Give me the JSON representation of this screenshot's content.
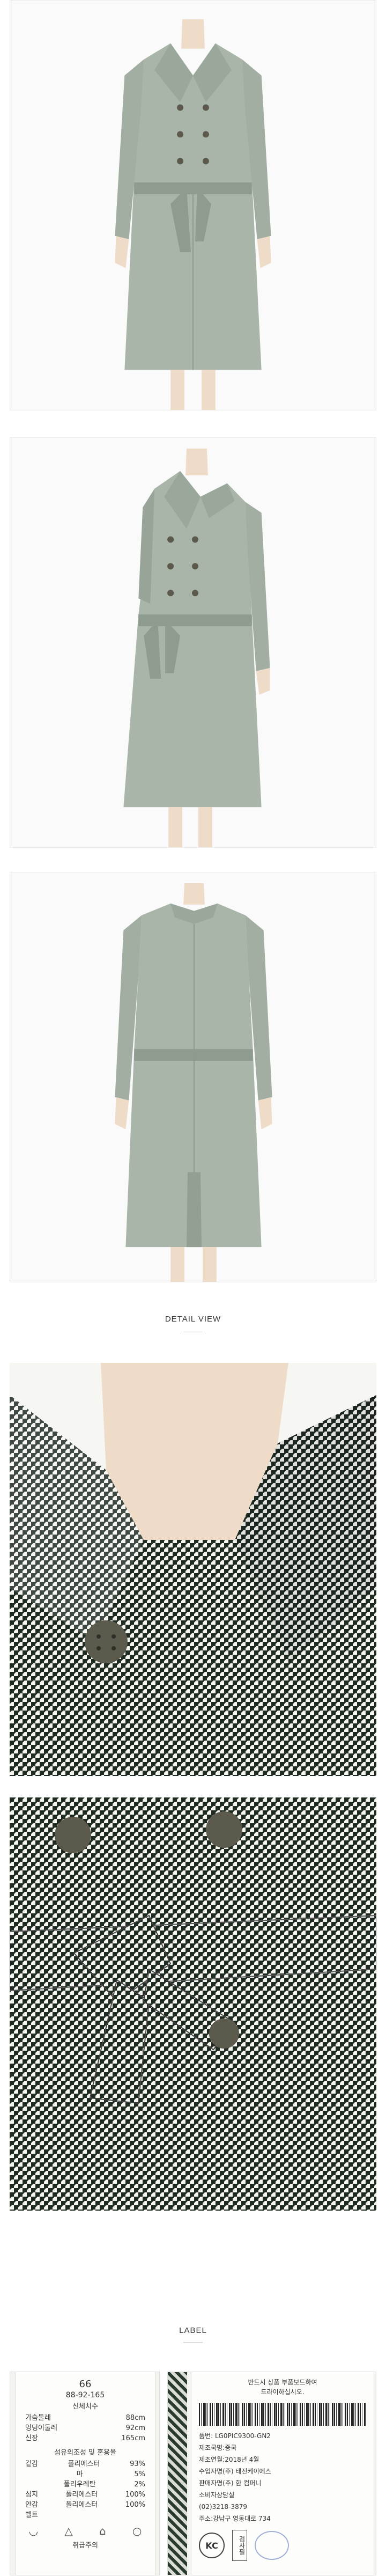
{
  "labels": {
    "detail_view": "DETAIL VIEW",
    "label": "LABEL"
  },
  "colors": {
    "coat_main": "#a9b5a9",
    "coat_shadow": "#8e9b8f",
    "button": "#5b5a4c",
    "skin": "#efdcc8",
    "houndstooth_dark": "#1f2a22",
    "houndstooth_light": "#f5f5f0"
  },
  "size_tag": {
    "size_code": "66",
    "size_numbers": "88-92-165",
    "body_size_title": "신체치수",
    "measurements": [
      {
        "name": "가슴둘레",
        "value": "88cm"
      },
      {
        "name": "엉덩이둘레",
        "value": "92cm"
      },
      {
        "name": "신장",
        "value": "165cm"
      }
    ],
    "fiber_title": "섬유의조성 및 혼용율",
    "fibers": [
      {
        "part": "겉감",
        "material": "폴리에스터",
        "pct": "93%"
      },
      {
        "part": "",
        "material": "마",
        "pct": "5%"
      },
      {
        "part": "",
        "material": "폴리우레탄",
        "pct": "2%"
      },
      {
        "part": "심지",
        "material": "폴리에스터",
        "pct": "100%"
      },
      {
        "part": "안감",
        "material": "폴리에스터",
        "pct": "100%"
      },
      {
        "part": "벨트",
        "material": "",
        "pct": ""
      }
    ],
    "care_title": "취급주의"
  },
  "info_tag": {
    "notice_line1": "반드시 상품 부품보드하여",
    "notice_line2": "드라이하십시오.",
    "lines": [
      "품번: LG0PIC9300-GN2",
      "제조국명:중국",
      "제조연월:2018년 4월",
      "수입자명(주) 태진케이에스",
      "판매자명(주) 한 컴퍼니",
      "소비자상담실",
      "(02)3218-3879",
      "주소:강남구 영동대로 734"
    ],
    "kc_mark": "KC",
    "inspection_stamp": "검사필"
  }
}
